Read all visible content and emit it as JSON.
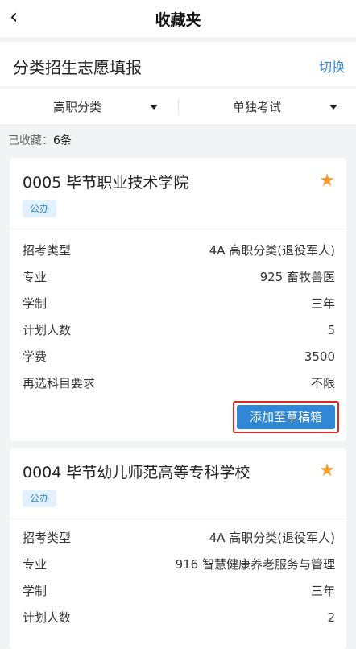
{
  "header": {
    "back_icon": "chevron-left-icon",
    "title": "收藏夹"
  },
  "section": {
    "title": "分类招生志愿填报",
    "switch_label": "切换"
  },
  "filters": [
    {
      "label": "高职分类",
      "icon": "caret-down-icon"
    },
    {
      "label": "单独考试",
      "icon": "caret-down-icon"
    }
  ],
  "saved": {
    "label": "已收藏：",
    "count": "6条"
  },
  "cards": [
    {
      "school": "0005 毕节职业技术学院",
      "tag": "公办",
      "rows": [
        {
          "k": "招考类型",
          "v": "4A 高职分类(退役军人)"
        },
        {
          "k": "专业",
          "v": "925 畜牧兽医"
        },
        {
          "k": "学制",
          "v": "三年"
        },
        {
          "k": "计划人数",
          "v": "5"
        },
        {
          "k": "学费",
          "v": "3500"
        },
        {
          "k": "再选科目要求",
          "v": "不限"
        }
      ],
      "button": "添加至草稿箱"
    },
    {
      "school": "0004 毕节幼儿师范高等专科学校",
      "tag": "公办",
      "rows": [
        {
          "k": "招考类型",
          "v": "4A 高职分类(退役军人)"
        },
        {
          "k": "专业",
          "v": "916 智慧健康养老服务与管理"
        },
        {
          "k": "学制",
          "v": "三年"
        },
        {
          "k": "计划人数",
          "v": "2"
        }
      ]
    }
  ],
  "colors": {
    "accent": "#2f87d6",
    "star": "#f39a2a",
    "highlight": "#e0281f"
  }
}
